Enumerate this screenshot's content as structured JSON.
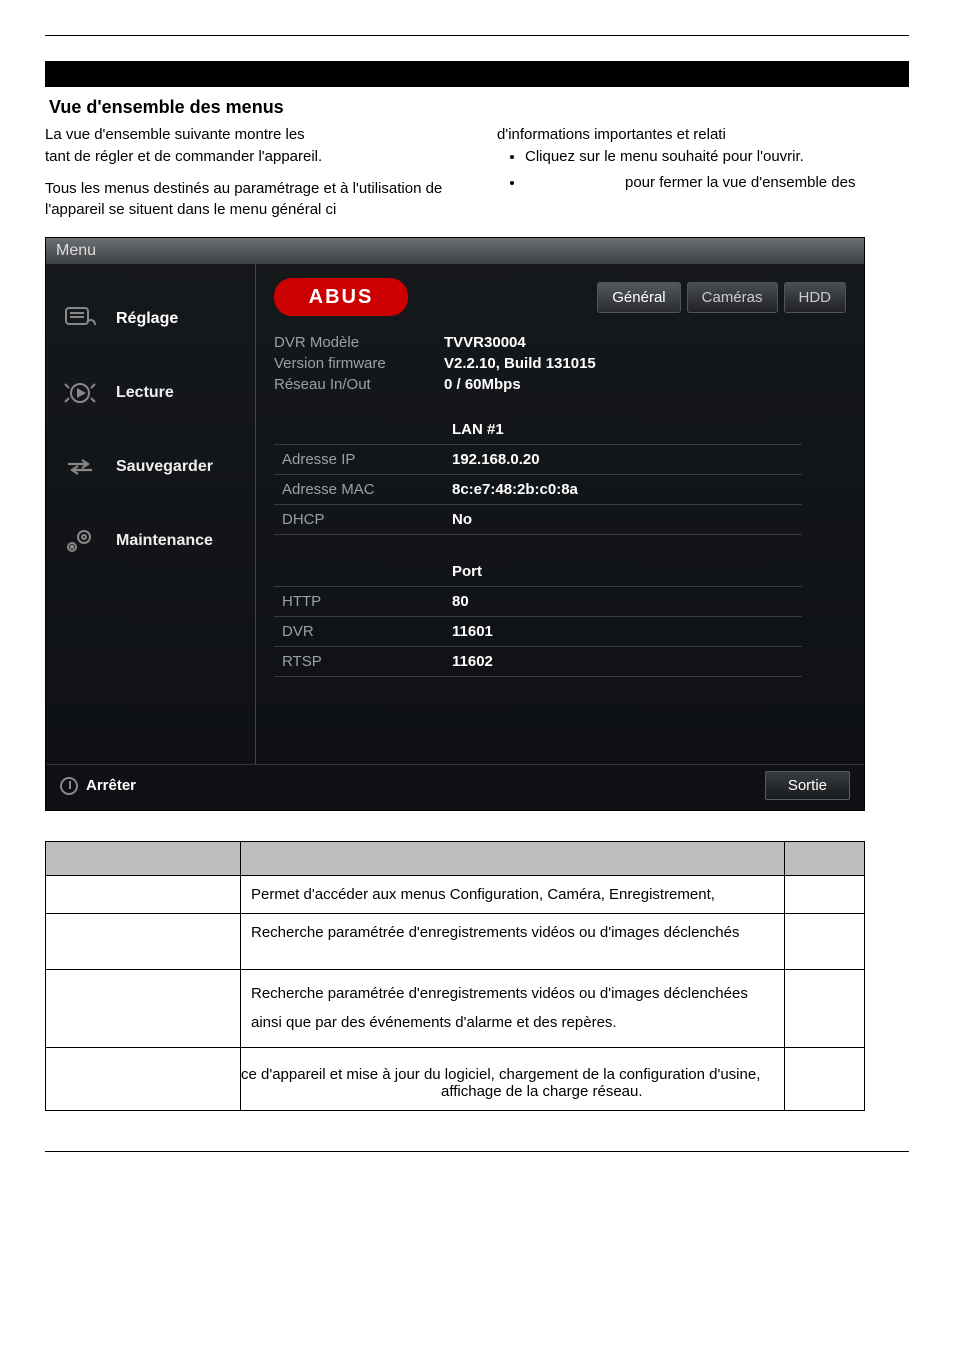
{
  "heading": "Vue d'ensemble des menus",
  "intro": {
    "p1": "La vue d'ensemble suivante montre les",
    "p2": "tant de régler et de commander l'appareil.",
    "p3": "Tous les menus destinés au paramétrage et à l'utilisation de l'appareil se situent dans le menu général ci",
    "p4": "d'informations importantes et relati",
    "b1": "Cliquez sur le menu souhaité pour l'ouvrir.",
    "b2": "pour fermer la vue d'ensemble des"
  },
  "dvr": {
    "title": "Menu",
    "logo": "ABUS",
    "tabs": {
      "general": "Général",
      "cameras": "Caméras",
      "hdd": "HDD"
    },
    "sidebar": {
      "settings": "Réglage",
      "playback": "Lecture",
      "backup": "Sauvegarder",
      "maintenance": "Maintenance"
    },
    "info": {
      "model_label": "DVR Modèle",
      "model_value": "TVVR30004",
      "fw_label": "Version firmware",
      "fw_value": "V2.2.10, Build 131015",
      "net_label": "Réseau In/Out",
      "net_value": "0 / 60Mbps"
    },
    "net_table": {
      "iface": "LAN #1",
      "ip_label": "Adresse IP",
      "ip_value": "192.168.0.20",
      "mac_label": "Adresse MAC",
      "mac_value": "8c:e7:48:2b:c0:8a",
      "dhcp_label": "DHCP",
      "dhcp_value": "No"
    },
    "port_table": {
      "port_header": "Port",
      "http_label": "HTTP",
      "http_value": "80",
      "dvr_label": "DVR",
      "dvr_value": "11601",
      "rtsp_label": "RTSP",
      "rtsp_value": "11602"
    },
    "footer": {
      "power": "Arrêter",
      "exit": "Sortie"
    }
  },
  "desc_table": {
    "r1": "Permet d'accéder aux menus Configuration, Caméra, Enregistrement,",
    "r2": "Recherche paramétrée d'enregistrements vidéos ou d'images déclenchés",
    "r3": "Recherche paramétrée d'enregistrements vidéos ou d'images déclenchées ainsi que par des événements d'alarme et des repères.",
    "r4": "ce d'appareil et mise à jour du logiciel, chargement de la configuration d'usine, affichage de la charge réseau."
  }
}
